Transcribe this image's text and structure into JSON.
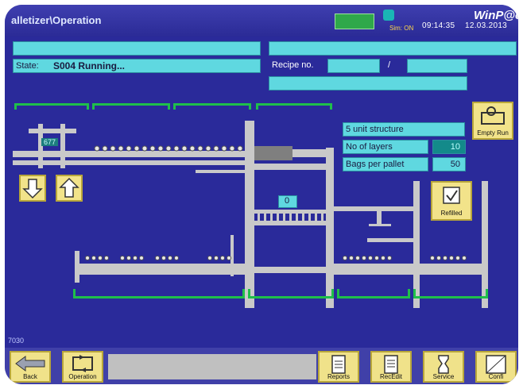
{
  "header": {
    "title": "alletizer\\Operation",
    "brand": "WinP@c",
    "sim_status": "Sim: ON",
    "time": "09:14:35",
    "date": "12.03.2013"
  },
  "state": {
    "label": "State:",
    "value": "S004 Running..."
  },
  "recipe": {
    "label": "Recipe no.",
    "separator": "/",
    "value1": "",
    "value2": ""
  },
  "info": {
    "structure": "5 unit structure",
    "layers_label": "No of layers",
    "layers_value": "10",
    "bags_label": "Bags per pallet",
    "bags_value": "50"
  },
  "buttons": {
    "empty_run": "Empty Run",
    "refilled": "Refilled"
  },
  "counters": {
    "conveyor_count": "677",
    "layer_count": "0"
  },
  "footer_code": "7030",
  "bottom_nav": [
    {
      "label": "Back"
    },
    {
      "label": "Operation"
    },
    {
      "label": "Reports"
    },
    {
      "label": "RecEdit"
    },
    {
      "label": "Service"
    },
    {
      "label": "Confi"
    }
  ],
  "colors": {
    "background": "#2a2a9a",
    "field": "#5fd8e0",
    "button": "#f2e38a",
    "bracket": "#1fbf4a"
  }
}
